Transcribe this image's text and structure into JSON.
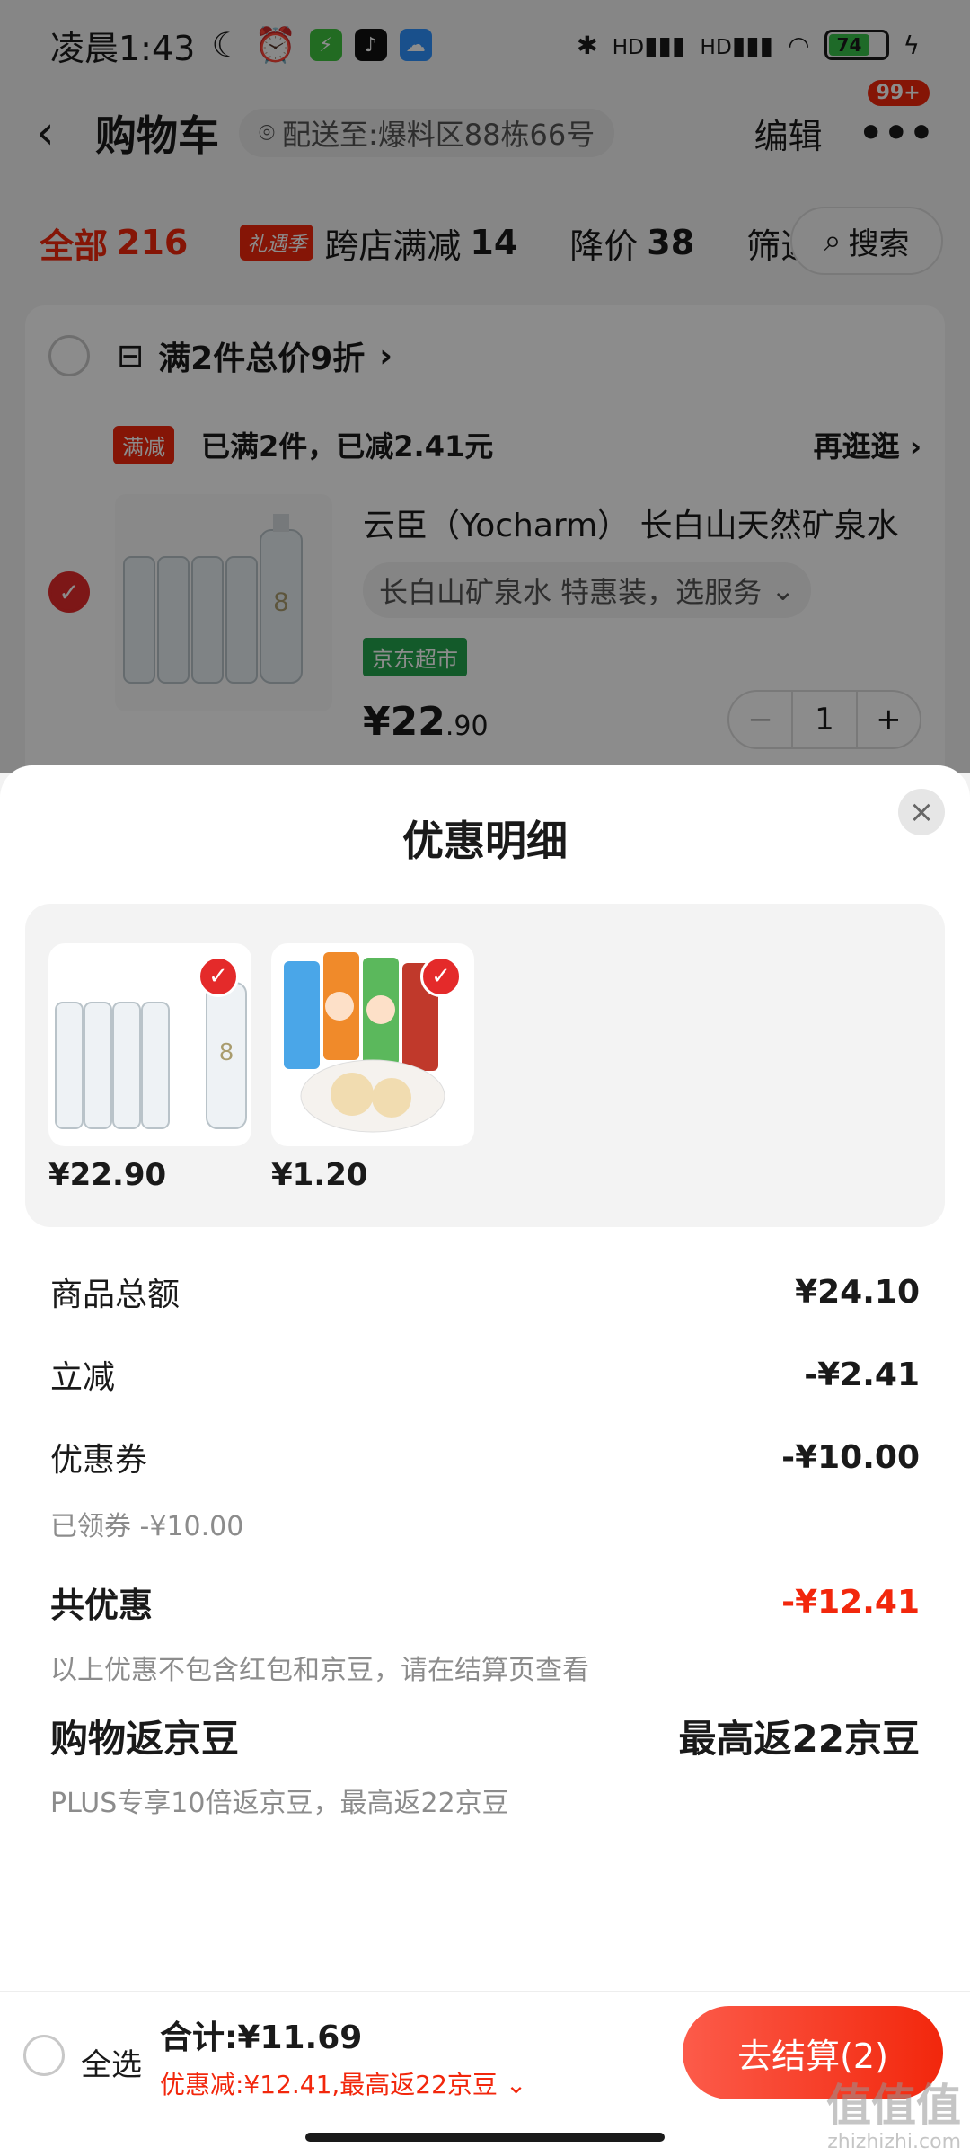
{
  "status": {
    "time": "凌晨1:43",
    "battery": "74",
    "network_labels": [
      "HD",
      "HD"
    ]
  },
  "nav": {
    "title": "购物车",
    "address": "配送至:爆料区88栋66号",
    "edit": "编辑",
    "badge": "99+"
  },
  "tabs": [
    {
      "label": "全部",
      "count": "216"
    },
    {
      "label": "跨店满减",
      "count": "14",
      "tag": "礼遇季"
    },
    {
      "label": "降价",
      "count": "38"
    },
    {
      "label": "筛选"
    }
  ],
  "search_label": "搜索",
  "cart": {
    "promo": "满2件总价9折",
    "promo_arrow": "›",
    "man_tag": "满减",
    "man_text": "已满2件，已减2.41元",
    "man_link": "再逛逛",
    "man_arrow": "›",
    "item": {
      "title": "云臣（Yocharm） 长白山天然矿泉水",
      "spec": "长白山矿泉水 特惠装，选服务",
      "store_tag": "京东超市",
      "price_int": "¥22",
      "price_dec": ".90",
      "qty": "1"
    }
  },
  "sheet": {
    "title": "优惠明细",
    "goods": [
      {
        "name": "water-bottles",
        "price": "¥22.90"
      },
      {
        "name": "lollipop-candy",
        "price": "¥1.20"
      }
    ],
    "rows": {
      "subtotal_label": "商品总额",
      "subtotal_value": "¥24.10",
      "instant_label": "立减",
      "instant_value": "-¥2.41",
      "coupon_label": "优惠券",
      "coupon_value": "-¥10.00",
      "coupon_sub": "已领券 -¥10.00",
      "total_disc_label": "共优惠",
      "total_disc_value": "-¥12.41",
      "total_disc_note": "以上优惠不包含红包和京豆，请在结算页查看",
      "beans_label": "购物返京豆",
      "beans_value": "最高返22京豆",
      "beans_note": "PLUS专享10倍返京豆，最高返22京豆"
    }
  },
  "footer": {
    "select_all": "全选",
    "total": "合计:¥11.69",
    "discount": "优惠减:¥12.41,最高返22京豆 ⌄",
    "checkout": "去结算(2)"
  },
  "watermark": {
    "big": "值值值",
    "small": "zhizhizhi.com"
  },
  "colors": {
    "accent": "#f2270c",
    "check": "#e42a2a",
    "store_tag": "#24a54e"
  }
}
